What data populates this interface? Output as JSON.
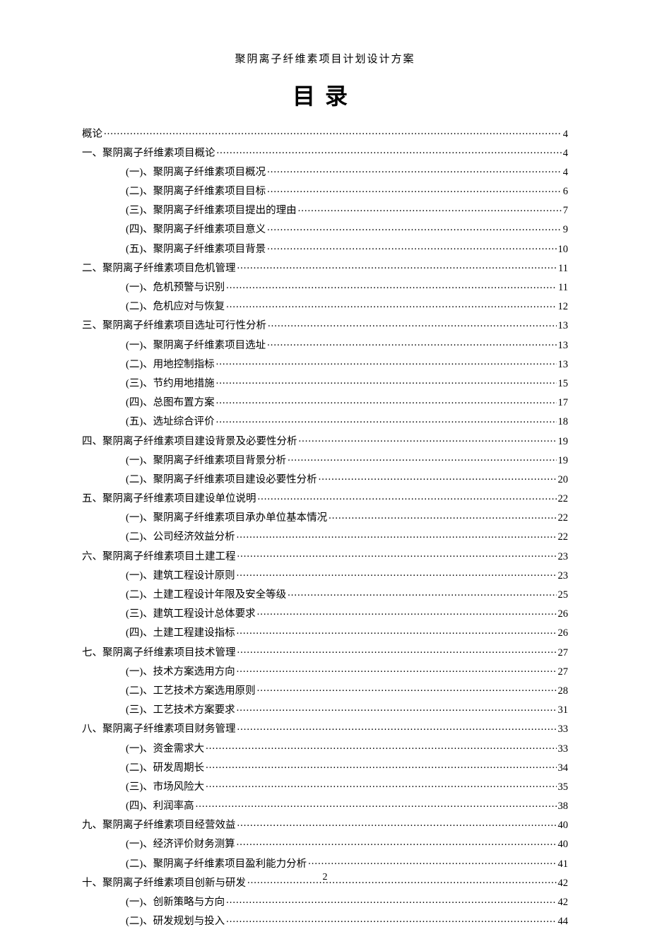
{
  "header": "聚阴离子纤维素项目计划设计方案",
  "tocTitle": "目录",
  "pageNumber": "2",
  "entries": [
    {
      "level": 0,
      "label": "概论",
      "page": "4"
    },
    {
      "level": 1,
      "label": "一、聚阴离子纤维素项目概论",
      "page": "4"
    },
    {
      "level": 2,
      "label": "(一)、聚阴离子纤维素项目概况",
      "page": "4"
    },
    {
      "level": 2,
      "label": "(二)、聚阴离子纤维素项目目标",
      "page": "6"
    },
    {
      "level": 2,
      "label": "(三)、聚阴离子纤维素项目提出的理由",
      "page": "7"
    },
    {
      "level": 2,
      "label": "(四)、聚阴离子纤维素项目意义",
      "page": "9"
    },
    {
      "level": 2,
      "label": "(五)、聚阴离子纤维素项目背景",
      "page": "10"
    },
    {
      "level": 1,
      "label": "二、聚阴离子纤维素项目危机管理",
      "page": "11"
    },
    {
      "level": 2,
      "label": "(一)、危机预警与识别",
      "page": "11"
    },
    {
      "level": 2,
      "label": "(二)、危机应对与恢复",
      "page": "12"
    },
    {
      "level": 1,
      "label": "三、聚阴离子纤维素项目选址可行性分析",
      "page": "13"
    },
    {
      "level": 2,
      "label": "(一)、聚阴离子纤维素项目选址",
      "page": "13"
    },
    {
      "level": 2,
      "label": "(二)、用地控制指标",
      "page": "13"
    },
    {
      "level": 2,
      "label": "(三)、节约用地措施",
      "page": "15"
    },
    {
      "level": 2,
      "label": "(四)、总图布置方案",
      "page": "17"
    },
    {
      "level": 2,
      "label": "(五)、选址综合评价",
      "page": "18"
    },
    {
      "level": 1,
      "label": "四、聚阴离子纤维素项目建设背景及必要性分析",
      "page": "19"
    },
    {
      "level": 2,
      "label": "(一)、聚阴离子纤维素项目背景分析",
      "page": "19"
    },
    {
      "level": 2,
      "label": "(二)、聚阴离子纤维素项目建设必要性分析",
      "page": "20"
    },
    {
      "level": 1,
      "label": "五、聚阴离子纤维素项目建设单位说明",
      "page": "22"
    },
    {
      "level": 2,
      "label": "(一)、聚阴离子纤维素项目承办单位基本情况",
      "page": "22"
    },
    {
      "level": 2,
      "label": "(二)、公司经济效益分析",
      "page": "22"
    },
    {
      "level": 1,
      "label": "六、聚阴离子纤维素项目土建工程",
      "page": "23"
    },
    {
      "level": 2,
      "label": "(一)、建筑工程设计原则",
      "page": "23"
    },
    {
      "level": 2,
      "label": "(二)、土建工程设计年限及安全等级",
      "page": "25"
    },
    {
      "level": 2,
      "label": "(三)、建筑工程设计总体要求",
      "page": "26"
    },
    {
      "level": 2,
      "label": "(四)、土建工程建设指标",
      "page": "26"
    },
    {
      "level": 1,
      "label": "七、聚阴离子纤维素项目技术管理",
      "page": "27"
    },
    {
      "level": 2,
      "label": "(一)、技术方案选用方向",
      "page": "27"
    },
    {
      "level": 2,
      "label": "(二)、工艺技术方案选用原则",
      "page": "28"
    },
    {
      "level": 2,
      "label": "(三)、工艺技术方案要求",
      "page": "31"
    },
    {
      "level": 1,
      "label": "八、聚阴离子纤维素项目财务管理",
      "page": "33"
    },
    {
      "level": 2,
      "label": "(一)、资金需求大",
      "page": "33"
    },
    {
      "level": 2,
      "label": "(二)、研发周期长",
      "page": "34"
    },
    {
      "level": 2,
      "label": "(三)、市场风险大",
      "page": "35"
    },
    {
      "level": 2,
      "label": "(四)、利润率高",
      "page": "38"
    },
    {
      "level": 1,
      "label": "九、聚阴离子纤维素项目经营效益",
      "page": "40"
    },
    {
      "level": 2,
      "label": "(一)、经济评价财务测算",
      "page": "40"
    },
    {
      "level": 2,
      "label": "(二)、聚阴离子纤维素项目盈利能力分析",
      "page": "41"
    },
    {
      "level": 1,
      "label": "十、聚阴离子纤维素项目创新与研发",
      "page": "42"
    },
    {
      "level": 2,
      "label": "(一)、创新策略与方向",
      "page": "42"
    },
    {
      "level": 2,
      "label": "(二)、研发规划与投入",
      "page": "44"
    }
  ]
}
